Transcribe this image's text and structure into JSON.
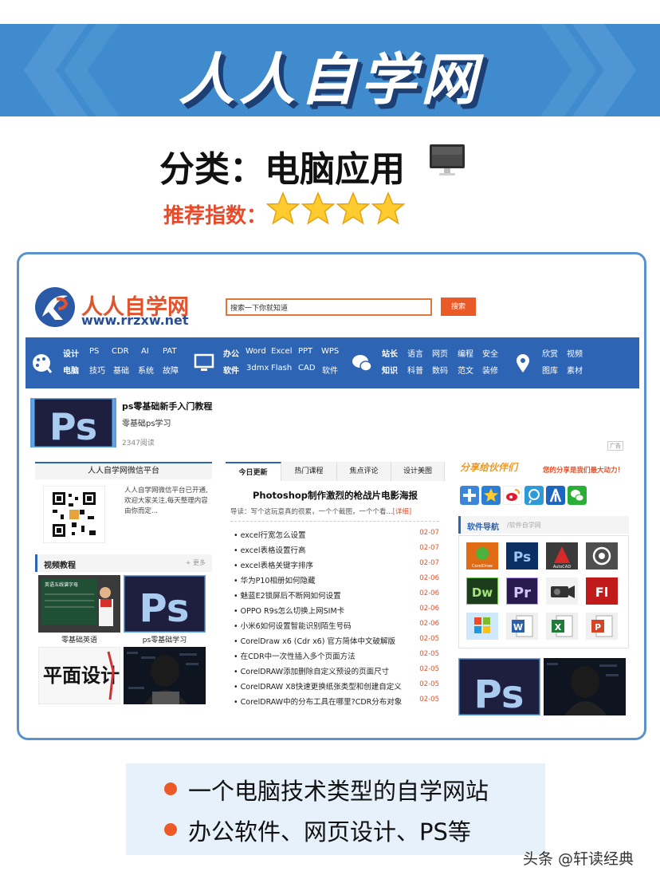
{
  "banner": {
    "title": "人人自学网"
  },
  "category": {
    "label": "分类：电脑应用",
    "icon": "desktop-monitor-icon"
  },
  "rating": {
    "label": "推荐指数：",
    "stars": 4,
    "max": 4
  },
  "site": {
    "logo_cn": "人人自学网",
    "logo_url": "www.rrzxw.net",
    "search_placeholder": "搜索一下你就知道",
    "search_button": "搜索",
    "nav": {
      "g1": [
        "设计",
        "PS",
        "CDR",
        "AI",
        "PAT",
        "电脑",
        "技巧",
        "基础",
        "系统",
        "故障"
      ],
      "g2": [
        "办公",
        "Word",
        "Excel",
        "PPT",
        "WPS",
        "软件",
        "3dmx",
        "Flash",
        "CAD",
        "软件"
      ],
      "g3": [
        "站长",
        "语言",
        "网页",
        "编程",
        "安全",
        "知识",
        "科普",
        "数码",
        "范文",
        "装修"
      ],
      "g4": [
        "欣赏",
        "视频",
        "图库",
        "素材"
      ]
    },
    "feature": {
      "title": "ps零基础新手入门教程",
      "subtitle": "零基础ps学习",
      "reads": "2347阅读",
      "ad": "广告"
    },
    "wechat": {
      "title": "人人自学网微信平台",
      "desc": "人人自学网微信平台已开通,欢迎大家关注,每天整理内容由你而定..."
    },
    "video": {
      "title": "视频教程",
      "more": "+ 更多",
      "items": [
        "零基础英语",
        "ps零基础学习"
      ]
    },
    "tabs": [
      "今日更新",
      "热门课程",
      "焦点评论",
      "设计美图"
    ],
    "article": {
      "title": "Photoshop制作激烈的枪战片电影海报",
      "lead": "导读：写个这玩意真的很累，一个个截图，一个个看...",
      "lead_more": "[详细]"
    },
    "news": [
      {
        "t": "• excel行宽怎么设置",
        "d": "02-07"
      },
      {
        "t": "• excel表格设置行高",
        "d": "02-07"
      },
      {
        "t": "• excel表格关键字排序",
        "d": "02-07"
      },
      {
        "t": "• 华为P10相册如何隐藏",
        "d": "02-06"
      },
      {
        "t": "• 魅蓝E2锁屏后不断网如何设置",
        "d": "02-06"
      },
      {
        "t": "• OPPO R9s怎么切换上网SIM卡",
        "d": "02-06"
      },
      {
        "t": "• 小米6如何设置智能识别陌生号码",
        "d": "02-06"
      },
      {
        "t": "• CorelDraw x6 (Cdr x6) 官方简体中文破解版",
        "d": "02-05"
      },
      {
        "t": "• 在CDR中一次性插入多个页面方法",
        "d": "02-05"
      },
      {
        "t": "• CorelDRAW添加删除自定义预设的页面尺寸",
        "d": "02-05"
      },
      {
        "t": "• CorelDRAW X8快速更换纸张类型和创建自定义",
        "d": "02-05"
      },
      {
        "t": "• CorelDRAW中的分布工具在哪里?CDR分布对象",
        "d": "02-05"
      }
    ],
    "share": {
      "title": "分享给伙伴们",
      "slogan": "您的分享是我们最大动力！"
    },
    "software": {
      "title": "软件导航",
      "sub": "/软件自学网",
      "apps": [
        "coreldraw-icon",
        "photoshop-icon",
        "autocad-icon",
        "premiere-icon-alt",
        "dreamweaver-icon",
        "premiere-icon",
        "video-camera-icon",
        "flash-icon",
        "windows-icon",
        "word-icon",
        "excel-icon",
        "powerpoint-icon"
      ],
      "coreldraw_label": "CorelDraw",
      "autocad_label": "AutoCAD"
    },
    "thumb_labels": {
      "pingmian": "平面设计"
    },
    "video_lesson_caption": "英语五线谱字母"
  },
  "bullets": [
    "一个电脑技术类型的自学网站",
    "办公软件、网页设计、PS等"
  ],
  "watermark": "头条 @轩读经典",
  "colors": {
    "banner": "#3f8bcd",
    "nav": "#2e64b4",
    "accent": "#e95a26",
    "frame": "#5a93cb"
  }
}
